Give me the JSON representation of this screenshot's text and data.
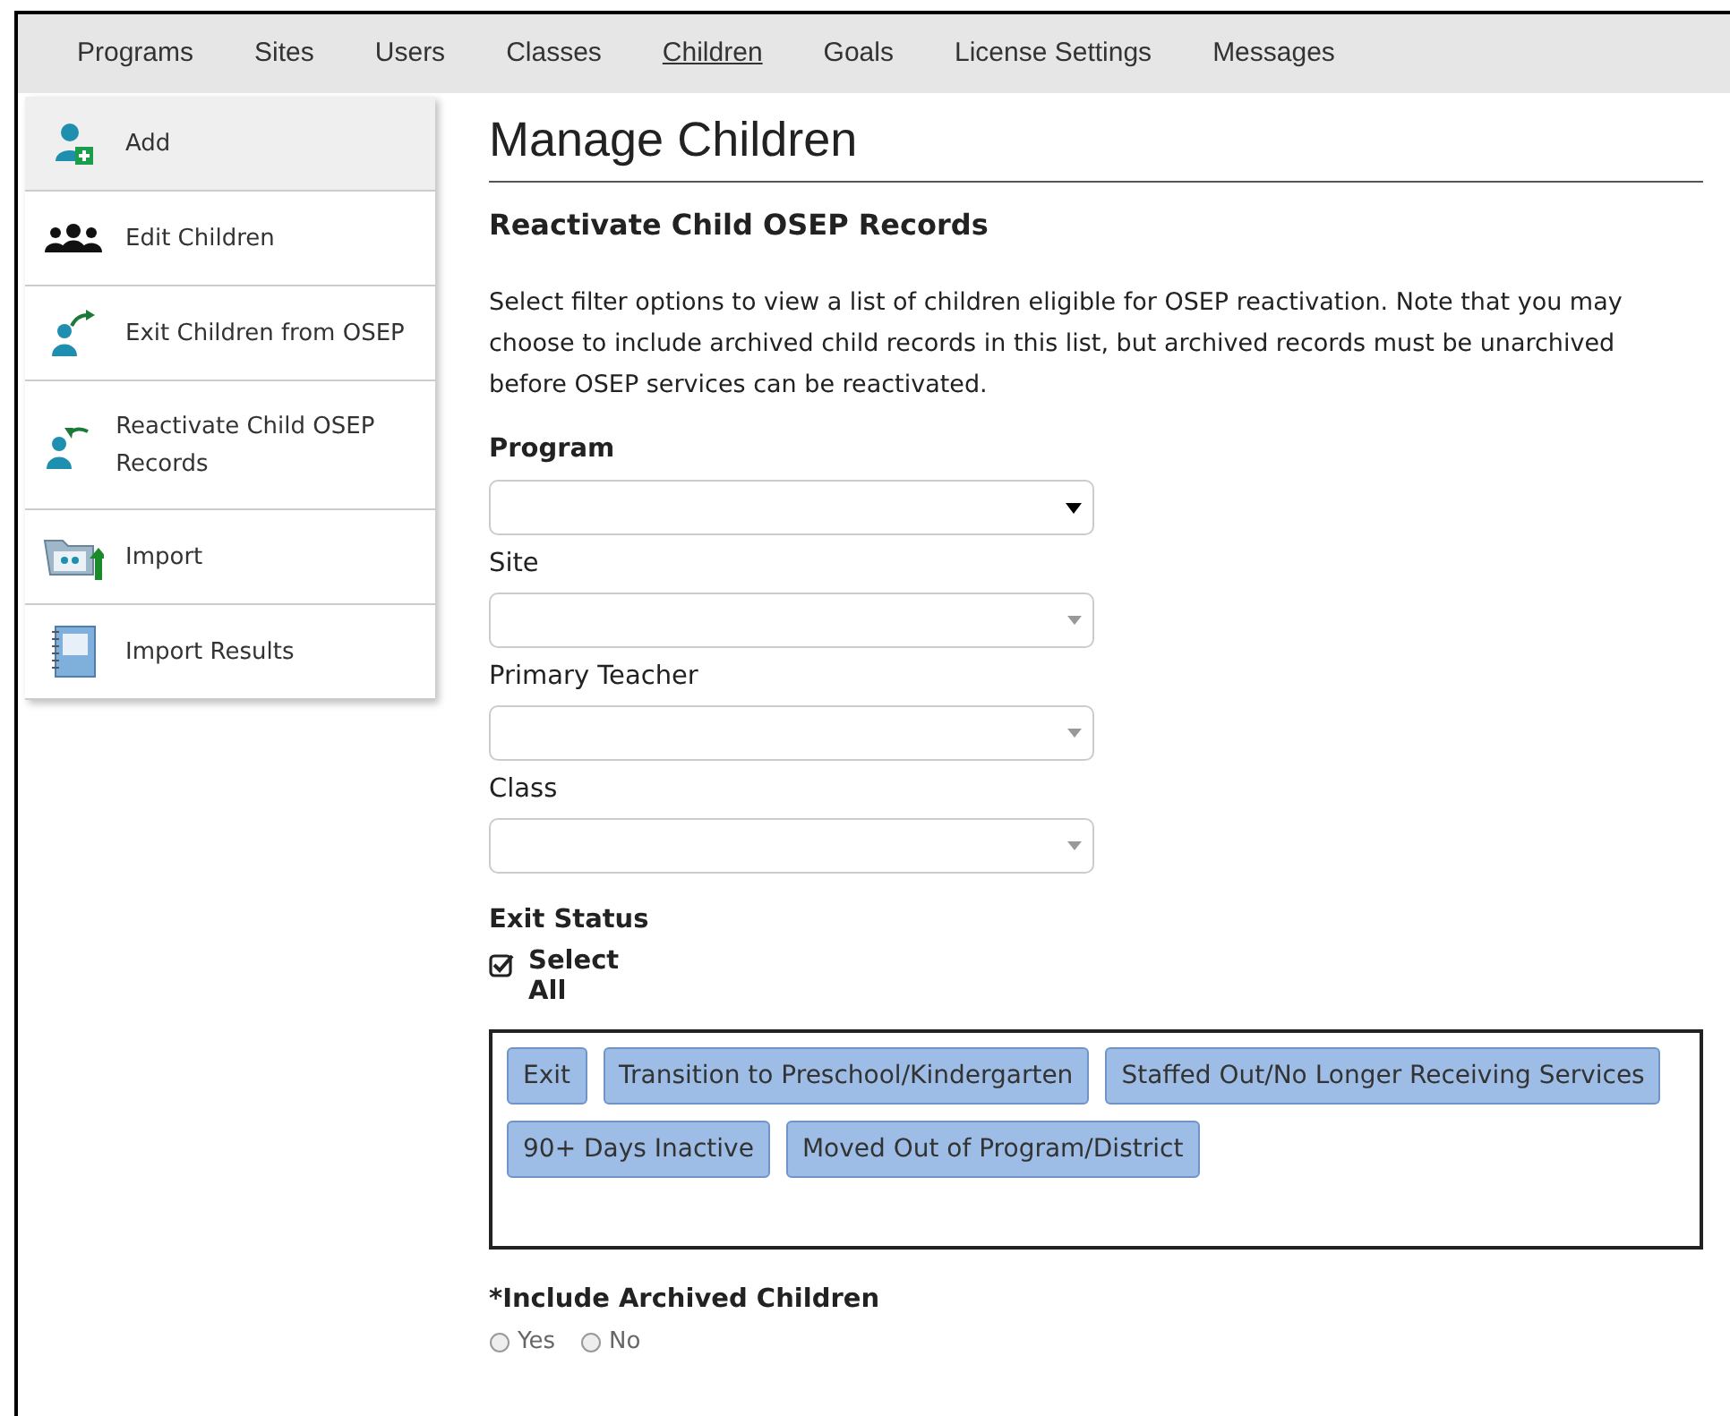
{
  "nav": [
    {
      "label": "Programs",
      "selected": false
    },
    {
      "label": "Sites",
      "selected": false
    },
    {
      "label": "Users",
      "selected": false
    },
    {
      "label": "Classes",
      "selected": false
    },
    {
      "label": "Children",
      "selected": true
    },
    {
      "label": "Goals",
      "selected": false
    },
    {
      "label": "License Settings",
      "selected": false
    },
    {
      "label": "Messages",
      "selected": false
    }
  ],
  "sidebar": {
    "items": [
      {
        "label": "Add",
        "kind": "add",
        "selected": true
      },
      {
        "label": "Edit Children",
        "kind": "group",
        "selected": false
      },
      {
        "label": "Exit Children from OSEP",
        "kind": "exit",
        "selected": false
      },
      {
        "label": "Reactivate Child OSEP Records",
        "kind": "reactivate",
        "selected": false
      },
      {
        "label": "Import",
        "kind": "import",
        "selected": false
      },
      {
        "label": "Import Results",
        "kind": "results",
        "selected": false
      }
    ]
  },
  "title": "Manage Children",
  "subtitle": "Reactivate Child OSEP Records",
  "description": "Select filter options to view a list of children eligible for OSEP reactivation. Note that you may choose to include archived child records in this list, but archived records must be unarchived before OSEP services can be reactivated.",
  "filters": [
    {
      "label": "Program",
      "disabled": false
    },
    {
      "label": "Site",
      "disabled": true
    },
    {
      "label": "Primary Teacher",
      "disabled": true
    },
    {
      "label": "Class",
      "disabled": true
    }
  ],
  "exit_status": {
    "label": "Exit Status",
    "select_all": {
      "label": "Select All",
      "checked": true
    },
    "tags": [
      "Exit",
      "Transition to Preschool/Kindergarten",
      "Staffed Out/No Longer Receiving Services",
      "90+ Days Inactive",
      "Moved Out of Program/District"
    ]
  },
  "archived": {
    "label": "*Include Archived Children",
    "options": [
      {
        "label": "Yes",
        "selected": false
      },
      {
        "label": "No",
        "selected": false
      }
    ]
  }
}
